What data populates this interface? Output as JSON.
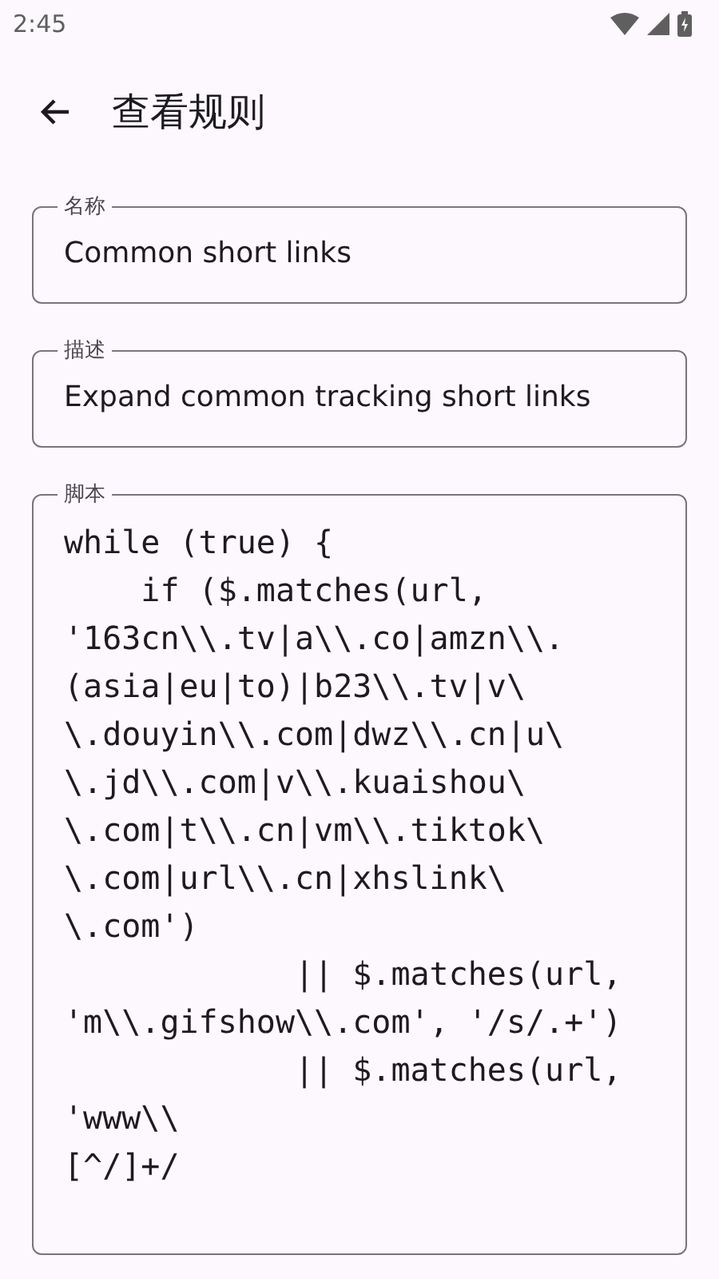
{
  "status_bar": {
    "time": "2:45"
  },
  "app_bar": {
    "title": "查看规则"
  },
  "fields": [
    {
      "label": "名称",
      "value": "Common short links"
    },
    {
      "label": "描述",
      "value": "Expand common tracking short links"
    }
  ],
  "script": {
    "label": "脚本",
    "lines": [
      "while (true) {",
      "    if ($.matches(url,",
      "'163cn\\\\.tv|a\\\\.co|amzn\\\\.",
      "(asia|eu|to)|b23\\\\.tv|v\\",
      "\\.douyin\\\\.com|dwz\\\\.cn|u\\",
      "\\.jd\\\\.com|v\\\\.kuaishou\\",
      "\\.com|t\\\\.cn|vm\\\\.tiktok\\",
      "\\.com|url\\\\.cn|xhslink\\",
      "\\.com')",
      "            || $.matches(url,",
      "'m\\\\.gifshow\\\\.com', '/s/.+')",
      "            || $.matches(url,",
      "'www\\\\",
      "[^/]+/"
    ]
  }
}
